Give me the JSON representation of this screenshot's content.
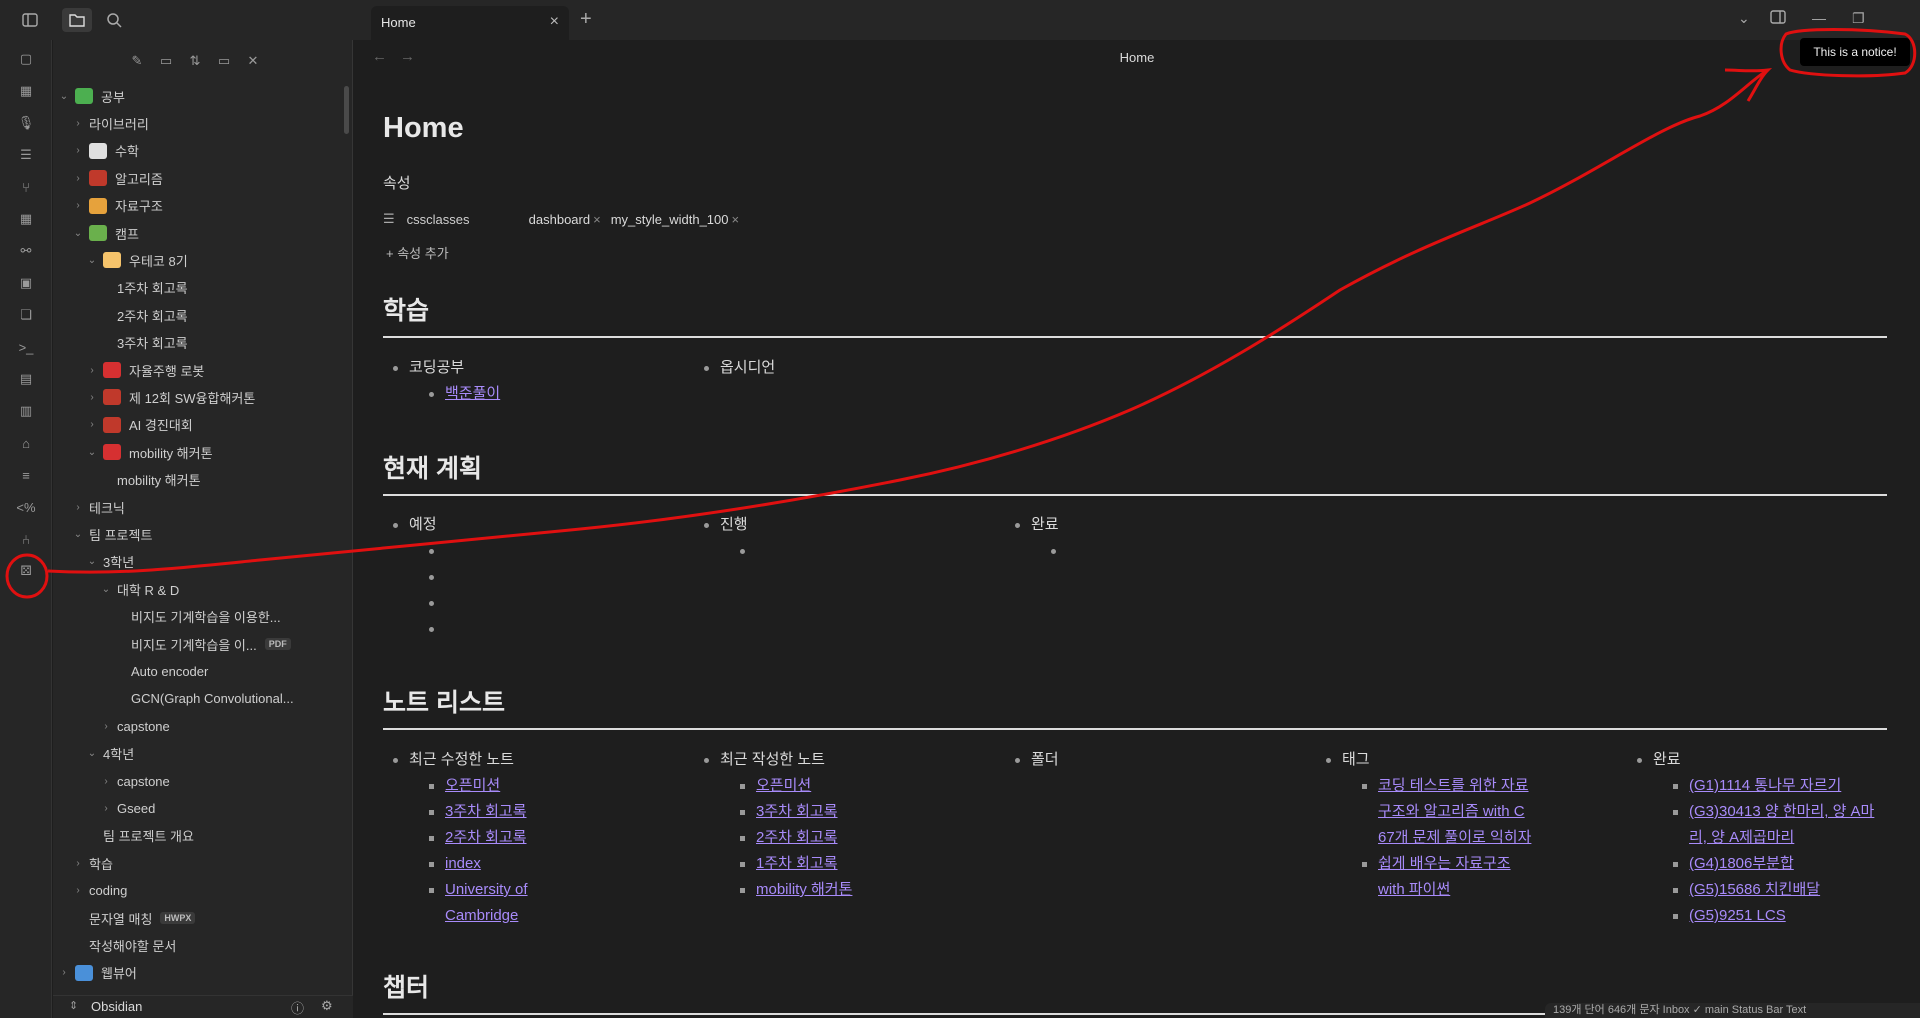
{
  "tab": {
    "title": "Home"
  },
  "view": {
    "title": "Home"
  },
  "notice": "This is a notice!",
  "note": {
    "title": "Home",
    "properties_heading": "속성",
    "property_key": "cssclasses",
    "property_values": [
      "dashboard",
      "my_style_width_100"
    ],
    "add_property": "속성 추가"
  },
  "sections": {
    "study": {
      "title": "학습",
      "cols": [
        {
          "head": "코딩공부",
          "links": [
            "백준풀이"
          ]
        },
        {
          "head": "옵시디언",
          "links": []
        }
      ]
    },
    "plan": {
      "title": "현재 계획",
      "cols": [
        {
          "head": "예정"
        },
        {
          "head": "진행"
        },
        {
          "head": "완료"
        }
      ]
    },
    "notes": {
      "title": "노트 리스트",
      "cols": [
        {
          "head": "최근 수정한 노트",
          "links": [
            "오픈미션",
            "3주차 회고록",
            "2주차 회고록",
            "index",
            "University of Cambridge"
          ]
        },
        {
          "head": "최근 작성한 노트",
          "links": [
            "오픈미션",
            "3주차 회고록",
            "2주차 회고록",
            "1주차 회고록",
            "mobility 해커톤"
          ]
        },
        {
          "head": "폴더",
          "links": []
        },
        {
          "head": "태그",
          "links": [
            "코딩 테스트를 위한 자료 구조와 알고리즘 with C 67개 문제 풀이로 익히자",
            "쉽게 배우는 자료구조 with 파이썬"
          ]
        },
        {
          "head": "완료",
          "links": [
            "(G1)1114 통나무 자르기",
            "(G3)30413 양 한마리, 양 A마리, 양 A제곱마리",
            "(G4)1806부분합",
            "(G5)15686 치킨배달",
            "(G5)9251 LCS"
          ]
        }
      ]
    },
    "chapter": {
      "title": "챕터"
    }
  },
  "tree": [
    {
      "label": "공부",
      "icon": "books-icon",
      "color": "#4caf50"
    },
    {
      "label": "라이브러리"
    },
    {
      "label": "수학",
      "icon": "chart-icon",
      "color": "#e0e0e0"
    },
    {
      "label": "알고리즘",
      "icon": "robot-icon",
      "color": "#c0392b"
    },
    {
      "label": "자료구조",
      "icon": "cabinet-icon",
      "color": "#e6a23c"
    },
    {
      "label": "캠프",
      "icon": "camp-icon",
      "color": "#6ab04c"
    },
    {
      "label": "우테코 8기",
      "icon": "person-icon",
      "color": "#f5c36b"
    },
    {
      "label": "1주차 회고록"
    },
    {
      "label": "2주차 회고록"
    },
    {
      "label": "3주차 회고록"
    },
    {
      "label": "자율주행 로봇",
      "icon": "car-icon",
      "color": "#d63031"
    },
    {
      "label": "제 12회 SW융합해커톤",
      "icon": "robot-icon",
      "color": "#c0392b"
    },
    {
      "label": "AI 경진대회",
      "icon": "robot-icon",
      "color": "#c0392b"
    },
    {
      "label": "mobility 해커톤",
      "icon": "car-icon",
      "color": "#d63031"
    },
    {
      "label": "mobility 해커톤"
    },
    {
      "label": "테크닉"
    },
    {
      "label": "팀 프로젝트"
    },
    {
      "label": "3학년"
    },
    {
      "label": "대학 R & D"
    },
    {
      "label": "비지도 기계학습을 이용한..."
    },
    {
      "label": "비지도 기계학습을 이...",
      "badge": "PDF"
    },
    {
      "label": "Auto encoder"
    },
    {
      "label": "GCN(Graph Convolutional..."
    },
    {
      "label": "capstone"
    },
    {
      "label": "4학년"
    },
    {
      "label": "capstone"
    },
    {
      "label": "Gseed"
    },
    {
      "label": "팀 프로젝트 개요"
    },
    {
      "label": "학습"
    },
    {
      "label": "coding"
    },
    {
      "label": "문자열 매칭",
      "badge": "HWPX"
    },
    {
      "label": "작성해야할 문서"
    },
    {
      "label": "웹뷰어",
      "icon": "monitor-icon",
      "color": "#4a90d9"
    }
  ],
  "vault": {
    "name": "Obsidian"
  },
  "status_bar": {
    "text": "139개 단어 646개 문자 Inbox ✓ main Status Bar Text"
  },
  "colors": {
    "link": "#a88bfa",
    "annotation": "#e01010",
    "background": "#1e1e1e",
    "sidebar": "#262626"
  }
}
